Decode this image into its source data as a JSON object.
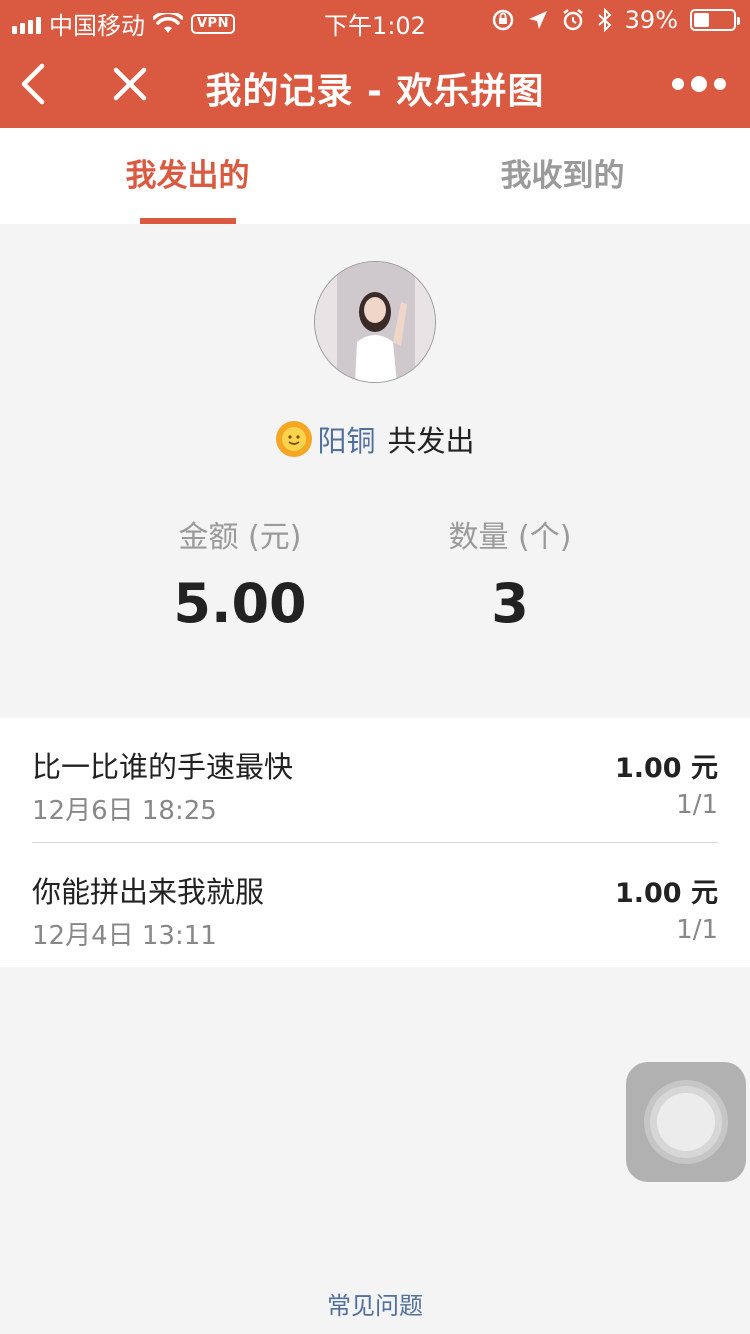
{
  "status_bar": {
    "carrier": "中国移动",
    "vpn": "VPN",
    "time": "下午1:02",
    "battery": "39%",
    "battery_level": 0.39
  },
  "nav": {
    "title": "我的记录 - 欢乐拼图"
  },
  "tabs": [
    {
      "label": "我发出的",
      "active": true
    },
    {
      "label": "我收到的",
      "active": false
    }
  ],
  "summary": {
    "name": "阳铜",
    "suffix": "共发出",
    "amount_label": "金额 (元)",
    "amount_value": "5.00",
    "count_label": "数量 (个)",
    "count_value": "3"
  },
  "records": [
    {
      "title": "比一比谁的手速最快",
      "date": "12月6日 18:25",
      "amount": "1.00 元",
      "count": "1/1"
    },
    {
      "title": "你能拼出来我就服",
      "date": "12月4日 13:11",
      "amount": "1.00 元",
      "count": "1/1"
    }
  ],
  "footer": {
    "faq": "常见问题"
  },
  "colors": {
    "accent": "#d95a40",
    "link": "#51709d"
  }
}
